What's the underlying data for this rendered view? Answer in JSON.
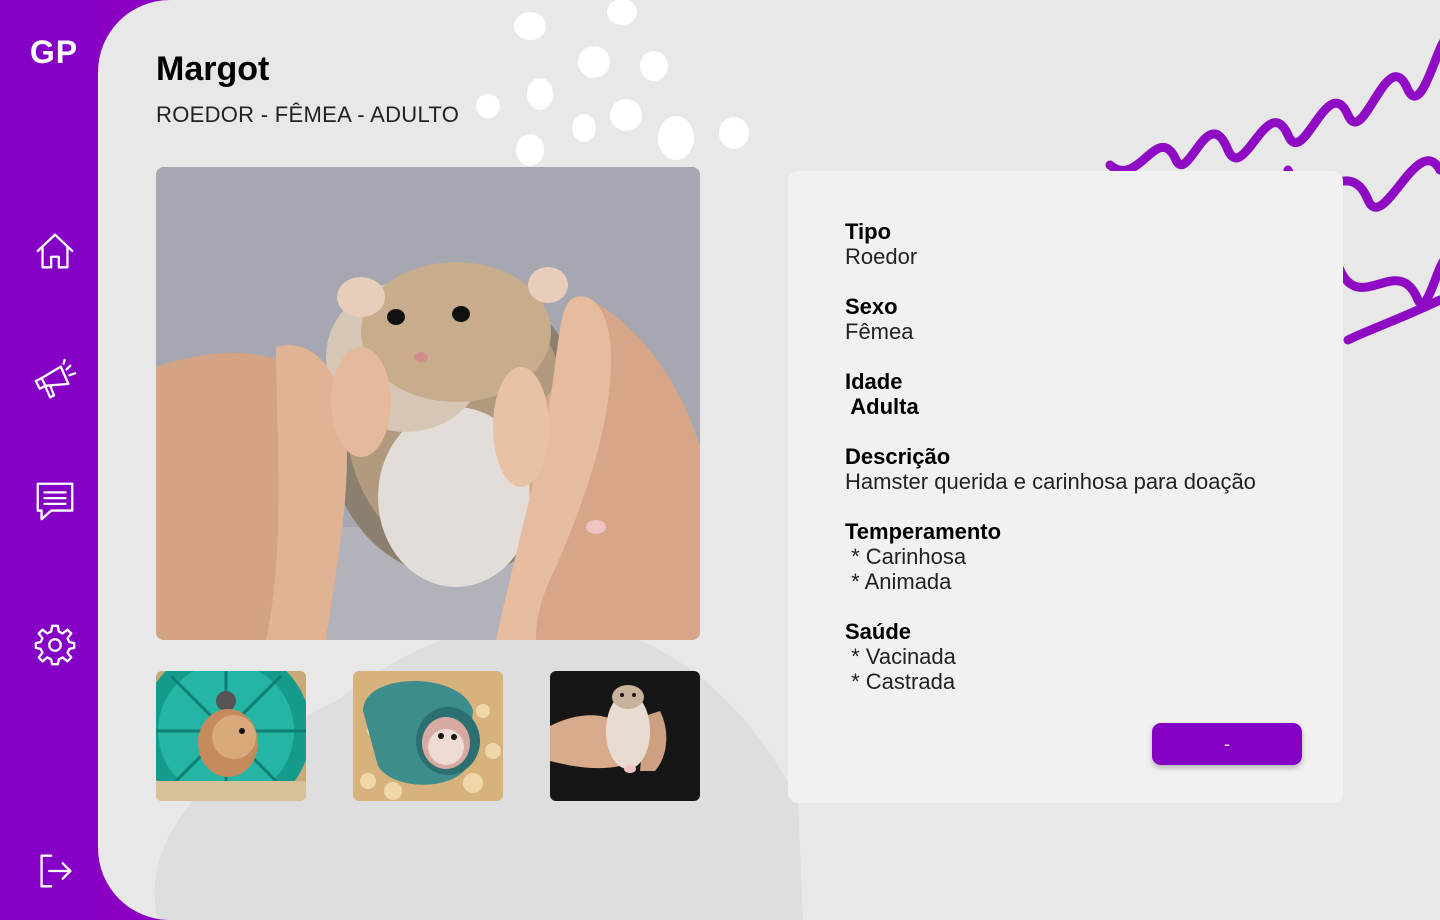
{
  "app": {
    "logo": "GP"
  },
  "sidebar": {
    "items": [
      {
        "name": "home",
        "icon": "home-icon"
      },
      {
        "name": "announcements",
        "icon": "megaphone-icon"
      },
      {
        "name": "messages",
        "icon": "chat-icon"
      },
      {
        "name": "settings",
        "icon": "gear-icon"
      },
      {
        "name": "logout",
        "icon": "logout-icon"
      }
    ]
  },
  "pet": {
    "name": "Margot",
    "subtitle": "ROEDOR - FÊMEA - ADULTO",
    "details": {
      "tipo": {
        "label": "Tipo",
        "value": "Roedor"
      },
      "sexo": {
        "label": "Sexo",
        "value": "Fêmea"
      },
      "idade": {
        "label": "Idade",
        "value": " Adulta"
      },
      "descricao": {
        "label": "Descrição",
        "value": "Hamster querida e carinhosa para doação"
      },
      "temperamento": {
        "label": "Temperamento",
        "value": " * Carinhosa\n * Animada"
      },
      "saude": {
        "label": "Saúde",
        "value": " * Vacinada\n * Castrada"
      }
    },
    "action_button": "-"
  },
  "colors": {
    "primary": "#8300c4",
    "background": "#e8e8e8",
    "card": "#f1f1f1"
  }
}
